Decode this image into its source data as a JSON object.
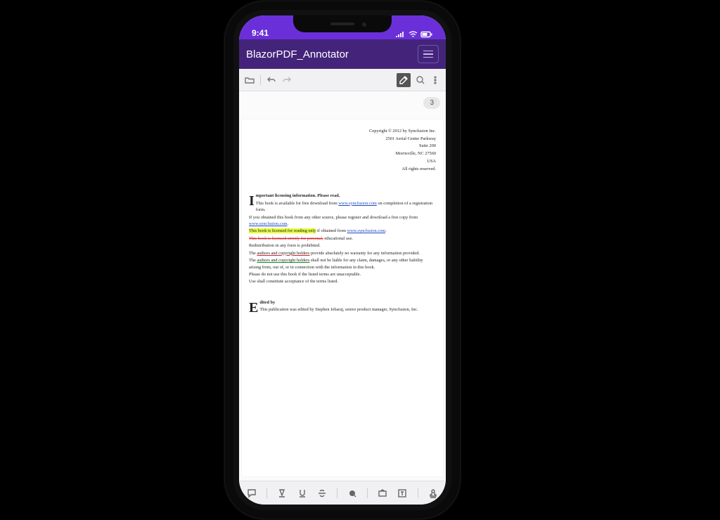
{
  "status": {
    "time": "9:41"
  },
  "header": {
    "title": "BlazorPDF_Annotator"
  },
  "toolbar": {
    "open": "open-icon",
    "undo": "undo-icon",
    "redo": "redo-icon",
    "annot": "annotate-icon",
    "search": "search-icon",
    "more": "more-icon"
  },
  "page": {
    "number": "3"
  },
  "doc": {
    "copyright": "Copyright © 2012 by Syncfusion Inc.",
    "addr1": "2501 Aerial Center Parkway",
    "addr2": "Suite 200",
    "addr3": "Morrisville, NC 27560",
    "addr4": "USA",
    "rights": "All rights reserved.",
    "drop1": "I",
    "h1": "mportant licensing information. Please read.",
    "p1a": "This book is available for free download from ",
    "p1link": "www.syncfusion.com",
    "p1b": " on completion of a registration form.",
    "p2a": "If you obtained this book from any other source, please register and download a free copy from ",
    "p2link": "www.syncfusion.com",
    "p2b": ".",
    "p3hl": "This book is licensed for reading only",
    "p3b": " if obtained from ",
    "p3link": "www.syncfusion.com",
    "p3c": ".",
    "p4strike": "This book is licensed strictly for personal,",
    "p4b": " educational use.",
    "p5": "Redistribution in any form is prohibited.",
    "p6a": "The ",
    "p6ul": "authors and copyright holders",
    "p6b": " provide absolutely no warranty for any information provided.",
    "p7a": "The ",
    "p7ul": "authors and copyright holders",
    "p7b": " shall not be liable for any claim, damages, or any other liability arising from, out of, or in connection with the information in this book.",
    "p8": "Please do not use this book if the listed terms are unacceptable.",
    "p9": "Use shall constitute acceptance of the terms listed.",
    "drop2": "E",
    "h2": "dited by",
    "p10": "This publication was edited by Stephen Jebaraj, senior product manager, Syncfusion, Inc."
  },
  "bottom": {
    "b1": "comment-icon",
    "b2": "highlight-icon",
    "b3": "underline-icon",
    "b4": "strike-icon",
    "b5": "ink-icon",
    "b6": "shape-icon",
    "b7": "textbox-icon",
    "b8": "stamp-icon"
  }
}
